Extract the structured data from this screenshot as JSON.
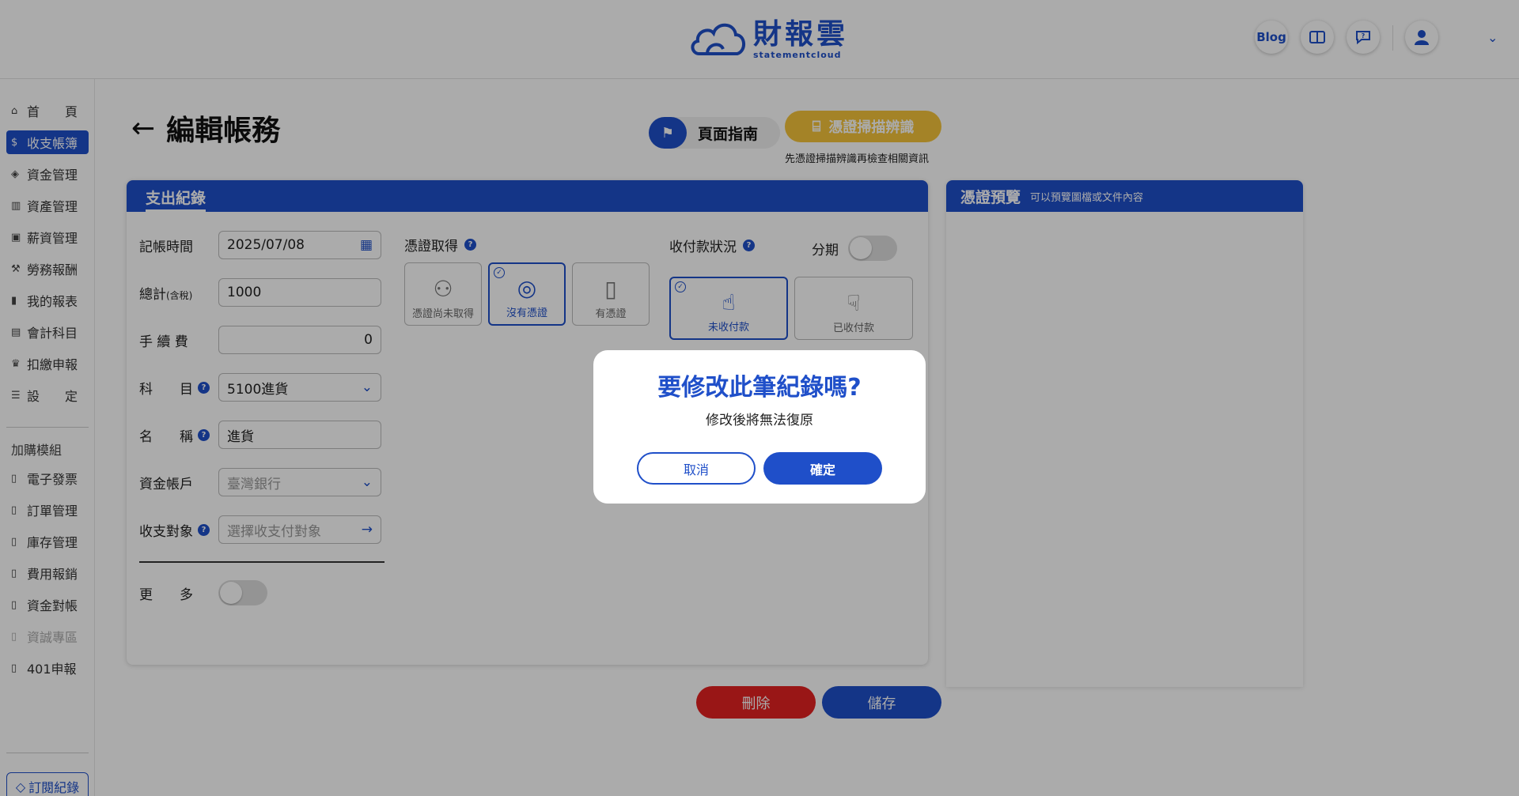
{
  "header": {
    "logo_zh": "財報雲",
    "logo_en": "statementcloud",
    "blog_label": "Blog"
  },
  "sidebar": {
    "items": [
      {
        "label": "首　　頁",
        "icon": "home-icon"
      },
      {
        "label": "收支帳簿",
        "icon": "ledger-icon"
      },
      {
        "label": "資金管理",
        "icon": "funds-icon"
      },
      {
        "label": "資產管理",
        "icon": "assets-icon"
      },
      {
        "label": "薪資管理",
        "icon": "payroll-icon"
      },
      {
        "label": "勞務報酬",
        "icon": "labor-icon"
      },
      {
        "label": "我的報表",
        "icon": "report-icon"
      },
      {
        "label": "會計科目",
        "icon": "accounts-icon"
      },
      {
        "label": "扣繳申報",
        "icon": "withholding-icon"
      },
      {
        "label": "設　　定",
        "icon": "settings-icon"
      }
    ],
    "addon_label": "加購模組",
    "addons": [
      {
        "label": "電子發票"
      },
      {
        "label": "訂單管理"
      },
      {
        "label": "庫存管理"
      },
      {
        "label": "費用報銷"
      },
      {
        "label": "資金對帳"
      },
      {
        "label": "資誠專區"
      },
      {
        "label": "401申報"
      }
    ],
    "subscription_label": "訂閱紀錄"
  },
  "page": {
    "title": "編輯帳務",
    "guide_label": "頁面指南",
    "scan_label": "憑證掃描辨識",
    "scan_hint": "先憑證掃描辨識再檢查相關資訊"
  },
  "form": {
    "tab_label": "支出紀錄",
    "date_label": "記帳時間",
    "date_value": "2025/07/08",
    "total_label": "總計",
    "total_suffix": "(含稅)",
    "total_value": "1000",
    "fee_label": "手 續 費",
    "fee_value": "0",
    "subject_label": "科　　目",
    "subject_value": "5100進貨",
    "name_label": "名　　稱",
    "name_value": "進貨",
    "account_label": "資金帳戶",
    "account_value": "臺灣銀行",
    "counterparty_label": "收支對象",
    "counterparty_placeholder": "選擇收支付對象",
    "more_label": "更　　多",
    "voucher_label": "憑證取得",
    "voucher_options": [
      {
        "label": "憑證尚未取得",
        "selected": false
      },
      {
        "label": "沒有憑證",
        "selected": true
      },
      {
        "label": "有憑證",
        "selected": false
      }
    ],
    "payment_label": "收付款狀況",
    "installment_label": "分期",
    "payment_options": [
      {
        "label": "未收付款",
        "selected": true
      },
      {
        "label": "已收付款",
        "selected": false
      }
    ]
  },
  "preview": {
    "title": "憑證預覽",
    "subtitle": "可以預覽圖檔或文件內容"
  },
  "actions": {
    "delete_label": "刪除",
    "save_label": "儲存"
  },
  "modal": {
    "title": "要修改此筆紀錄嗎?",
    "message": "修改後將無法復原",
    "cancel_label": "取消",
    "confirm_label": "確定"
  },
  "colors": {
    "primary": "#1f4fc9",
    "danger": "#e52222",
    "scan": "#f5c43b"
  }
}
